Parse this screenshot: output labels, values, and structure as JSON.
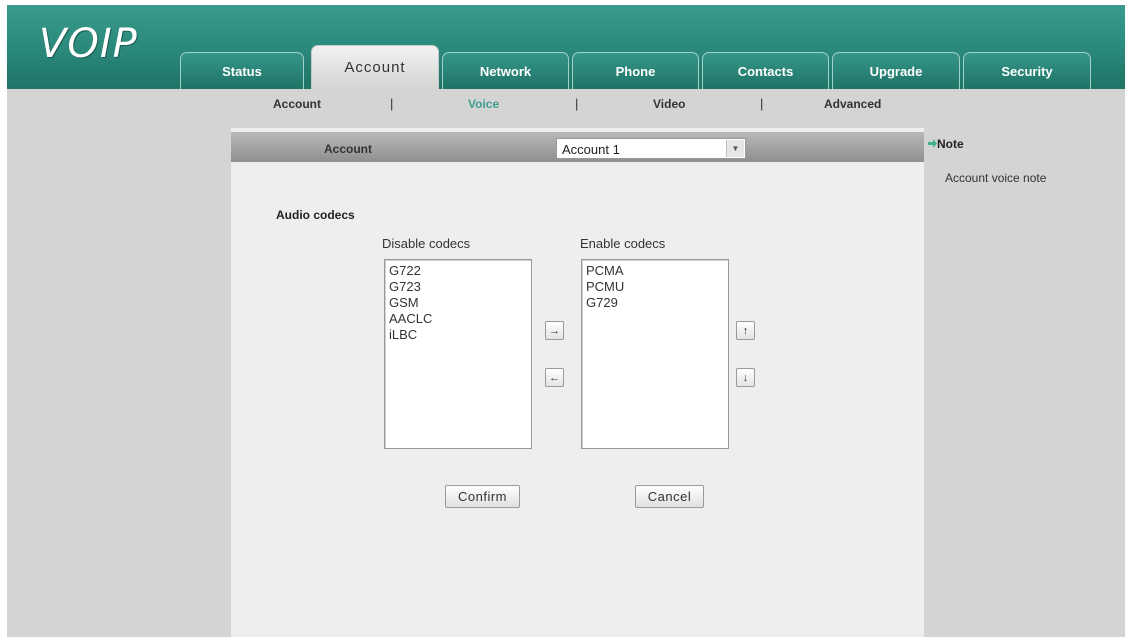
{
  "app": {
    "logo": "VOIP"
  },
  "tabs": [
    {
      "label": "Status"
    },
    {
      "label": "Account"
    },
    {
      "label": "Network"
    },
    {
      "label": "Phone"
    },
    {
      "label": "Contacts"
    },
    {
      "label": "Upgrade"
    },
    {
      "label": "Security"
    }
  ],
  "active_tab": "Account",
  "subnav": {
    "items": [
      {
        "label": "Account"
      },
      {
        "label": "Voice"
      },
      {
        "label": "Video"
      },
      {
        "label": "Advanced"
      }
    ],
    "separator": "|",
    "active": "Voice"
  },
  "account_bar": {
    "label": "Account",
    "selected": "Account 1"
  },
  "audio_codecs": {
    "section_label": "Audio codecs",
    "disable_heading": "Disable codecs",
    "enable_heading": "Enable codecs",
    "disabled": [
      "G722",
      "G723",
      "GSM",
      "AACLC",
      "iLBC"
    ],
    "enabled": [
      "PCMA",
      "PCMU",
      "G729"
    ],
    "move_right_glyph": "→",
    "move_left_glyph": "←",
    "move_up_glyph": "↑",
    "move_down_glyph": "↓"
  },
  "buttons": {
    "confirm": "Confirm",
    "cancel": "Cancel"
  },
  "note": {
    "title": "Note",
    "text": "Account voice note"
  },
  "colors": {
    "header_teal": "#2b8a7c",
    "active_subnav": "#3f9c8d",
    "page_gray": "#d4d4d4",
    "panel_bg": "#eeeeee"
  }
}
